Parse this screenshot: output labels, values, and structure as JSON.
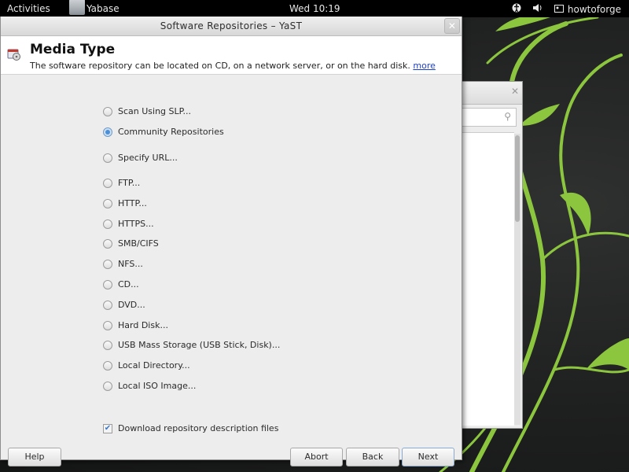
{
  "topbar": {
    "activities": "Activities",
    "app_name": "Yabase",
    "clock": "Wed 10:19",
    "user": "howtoforge"
  },
  "dialog": {
    "title": "Software Repositories – YaST",
    "header": {
      "title": "Media Type",
      "description": "The software repository can be located on CD, on a network server, or on the hard disk.",
      "more_link": "more"
    },
    "options": [
      {
        "label": "Scan Using SLP...",
        "selected": false
      },
      {
        "label": "Community Repositories",
        "selected": true
      },
      {
        "label": "Specify URL...",
        "selected": false
      },
      {
        "label": "FTP...",
        "selected": false
      },
      {
        "label": "HTTP...",
        "selected": false
      },
      {
        "label": "HTTPS...",
        "selected": false
      },
      {
        "label": "SMB/CIFS",
        "selected": false
      },
      {
        "label": "NFS...",
        "selected": false
      },
      {
        "label": "CD...",
        "selected": false
      },
      {
        "label": "DVD...",
        "selected": false
      },
      {
        "label": "Hard Disk...",
        "selected": false
      },
      {
        "label": "USB Mass Storage (USB Stick, Disk)...",
        "selected": false
      },
      {
        "label": "Local Directory...",
        "selected": false
      },
      {
        "label": "Local ISO Image...",
        "selected": false
      }
    ],
    "download_check": {
      "label": "Download repository description files",
      "checked": true
    },
    "buttons": {
      "help": "Help",
      "abort": "Abort",
      "back": "Back",
      "next": "Next"
    }
  },
  "colors": {
    "accent": "#4a90d9",
    "wallpaper_vine": "#8cc63f",
    "link": "#1a3fd0"
  },
  "icons": {
    "close": "close-icon",
    "search": "search-icon",
    "accessibility": "accessibility-icon",
    "volume": "volume-icon",
    "user": "user-icon",
    "repo": "repository-icon"
  }
}
